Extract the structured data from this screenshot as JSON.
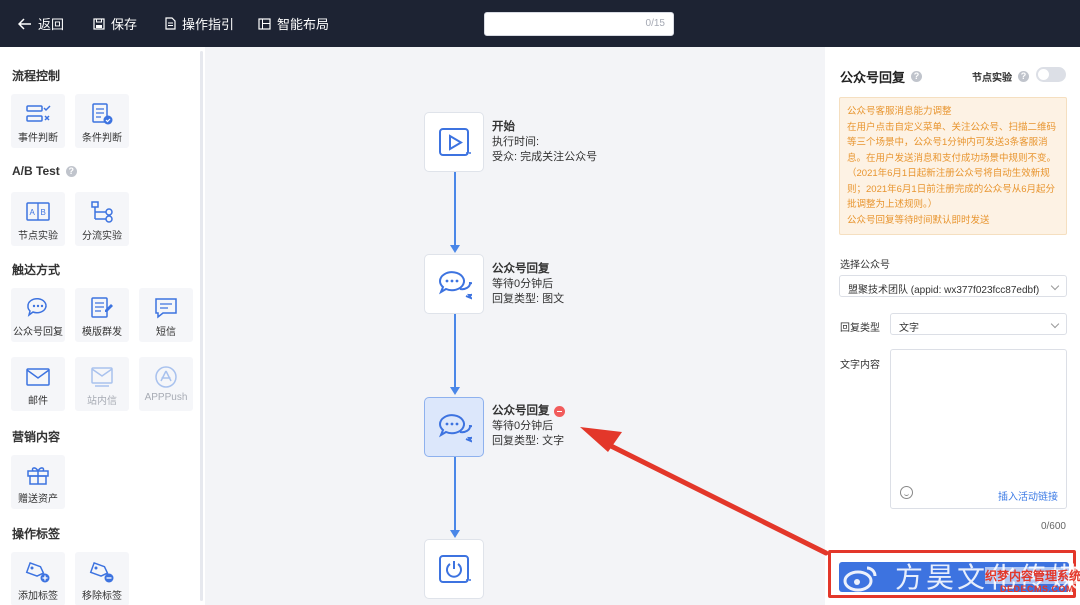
{
  "topbar": {
    "back": "返回",
    "save": "保存",
    "guide": "操作指引",
    "smart_layout": "智能布局",
    "title_value": "",
    "title_count": "0/15"
  },
  "left_panel": {
    "sections": [
      {
        "title": "流程控制",
        "items": [
          "事件判断",
          "条件判断"
        ]
      },
      {
        "title": "A/B Test",
        "items": [
          "节点实验",
          "分流实验"
        ]
      },
      {
        "title": "触达方式",
        "items": [
          "公众号回复",
          "模版群发",
          "短信",
          "邮件",
          "站内信",
          "APPPush"
        ]
      },
      {
        "title": "营销内容",
        "items": [
          "赠送资产"
        ]
      },
      {
        "title": "操作标签",
        "items": [
          "添加标签",
          "移除标签"
        ]
      }
    ]
  },
  "canvas": {
    "nodes": [
      {
        "title": "开始",
        "line1": "执行时间:",
        "line2": "受众:  完成关注公众号"
      },
      {
        "title": "公众号回复",
        "line1": "等待0分钟后",
        "line2": "回复类型:  图文"
      },
      {
        "title": "公众号回复",
        "line1": "等待0分钟后",
        "line2": "回复类型:  文字"
      },
      {
        "title": "",
        "line1": "",
        "line2": ""
      }
    ]
  },
  "right_panel": {
    "title": "公众号回复",
    "experiment_label": "节点实验",
    "notice": [
      "公众号客服消息能力调整",
      "在用户点击自定义菜单、关注公众号、扫描二维码",
      "等三个场景中，公众号1分钟内可发送3条客服消",
      "息。在用户发送消息和支付成功场景中规则不变。",
      "（2021年6月1日起新注册公众号将自动生效新规",
      "则；2021年6月1日前注册完成的公众号从6月起分",
      "批调整为上述规则。）",
      "公众号回复等待时间默认即时发送"
    ],
    "account_label": "选择公众号",
    "account_value": "盟聚技术团队 (appid: wx377f023fcc87edbf)",
    "reply_type_label": "回复类型",
    "reply_type_value": "文字",
    "text_content_label": "文字内容",
    "insert_link": "插入活动链接",
    "char_count": "0/600"
  },
  "watermark": {
    "text": "方昊文化传媒",
    "cn": "织梦内容管理系统",
    "en": "DEDECMS.COM"
  },
  "colors": {
    "topbar": "#1d2333",
    "primary": "#3d73e0",
    "connector": "#4a87e8",
    "notice_text": "#e8952f",
    "annotation_red": "#e3372a"
  }
}
